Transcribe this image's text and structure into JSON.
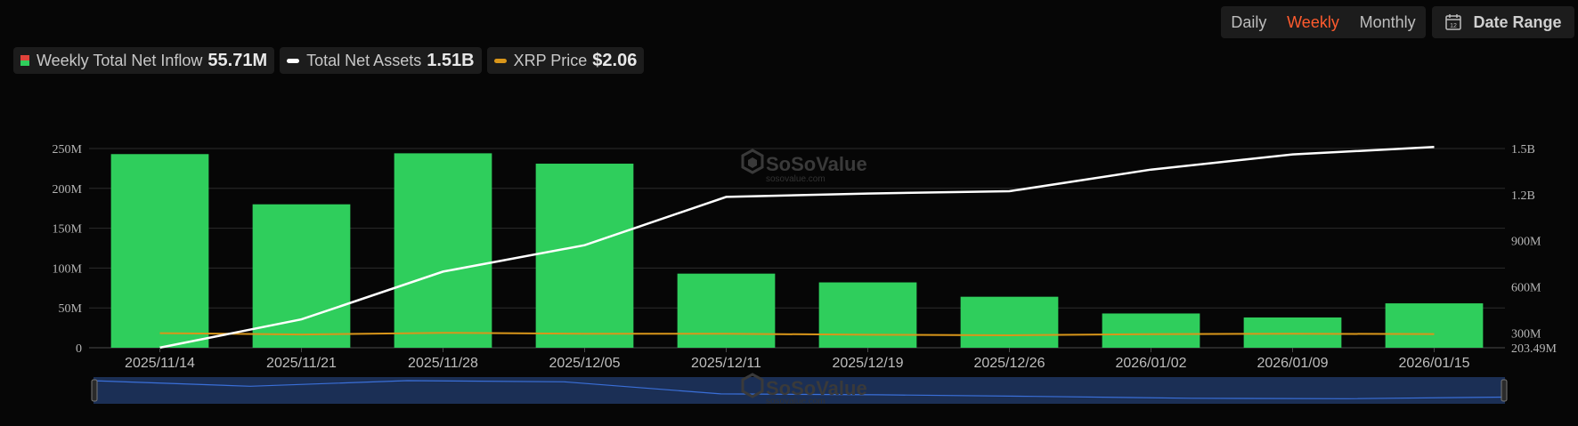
{
  "controls": {
    "periods": [
      "Daily",
      "Weekly",
      "Monthly"
    ],
    "active_period": "Weekly",
    "date_range_label": "Date Range",
    "calendar_day": "12"
  },
  "legend": {
    "inflow": {
      "name": "Weekly Total Net Inflow",
      "value": "55.71M"
    },
    "assets": {
      "name": "Total Net Assets",
      "value": "1.51B"
    },
    "price": {
      "name": "XRP Price",
      "value": "$2.06"
    }
  },
  "watermark": {
    "brand": "SoSoValue",
    "site": "sosovalue.com"
  },
  "colors": {
    "bar": "#2fce5c",
    "bar_negative": "#e0433a",
    "assets_line": "#ffffff",
    "price_line": "#d9961a",
    "accent": "#ff5b2e",
    "navigator_fill": "#1b2f55",
    "navigator_line": "#3a6fd8"
  },
  "chart_data": {
    "type": "bar",
    "categories": [
      "2025/11/14",
      "2025/11/21",
      "2025/11/28",
      "2025/12/05",
      "2025/12/11",
      "2025/12/19",
      "2025/12/26",
      "2026/01/02",
      "2026/01/09",
      "2026/01/15"
    ],
    "series": [
      {
        "name": "Weekly Total Net Inflow",
        "axis": "left",
        "kind": "bar",
        "values": [
          243,
          180,
          244,
          231,
          93,
          82,
          64,
          43,
          38,
          55.71
        ]
      },
      {
        "name": "Total Net Assets",
        "axis": "right",
        "kind": "line",
        "values": [
          204,
          388,
          699,
          871,
          1185,
          1207,
          1222,
          1363,
          1462,
          1510
        ]
      },
      {
        "name": "XRP Price",
        "axis": "none",
        "kind": "line",
        "values": [
          2.2,
          2.0,
          2.25,
          2.1,
          2.1,
          1.95,
          1.88,
          2.05,
          2.1,
          2.06
        ]
      }
    ],
    "left_axis": {
      "ticks": [
        0,
        50,
        100,
        150,
        200,
        250
      ],
      "labels": [
        "0",
        "50M",
        "100M",
        "150M",
        "200M",
        "250M"
      ],
      "ylim": [
        0,
        250
      ]
    },
    "right_axis": {
      "ticks": [
        203.49,
        300,
        600,
        900,
        1200,
        1500
      ],
      "labels": [
        "203.49M",
        "300M",
        "600M",
        "900M",
        "1.2B",
        "1.5B"
      ],
      "ylim": [
        203.49,
        1500
      ]
    },
    "price_range": [
      0,
      30
    ],
    "grid": true,
    "legend_position": "top-left"
  }
}
